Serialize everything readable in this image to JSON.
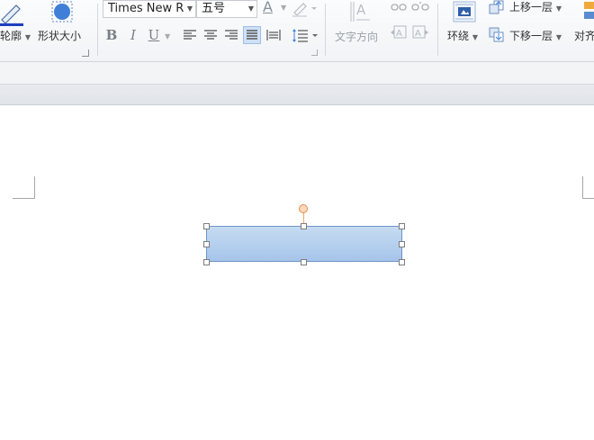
{
  "ribbon": {
    "outline_label": "轮廓",
    "shape_size_label": "形状大小",
    "font_name": "Times New R",
    "font_size": "五号",
    "text_direction_label": "文字方向",
    "wrap_label": "环绕",
    "bring_forward_label": "上移一层",
    "send_backward_label": "下移一层",
    "align_label": "对齐",
    "format": {
      "bold": "B",
      "italic": "I",
      "underline": "U"
    },
    "font_color_glyph": "A",
    "active_alignment": "justify"
  },
  "colors": {
    "shape_fill": "#b3cdee",
    "shape_border": "#6f95c6",
    "rotate_handle": "#f4a46a",
    "font_color_bar": "#1f3fbf"
  }
}
